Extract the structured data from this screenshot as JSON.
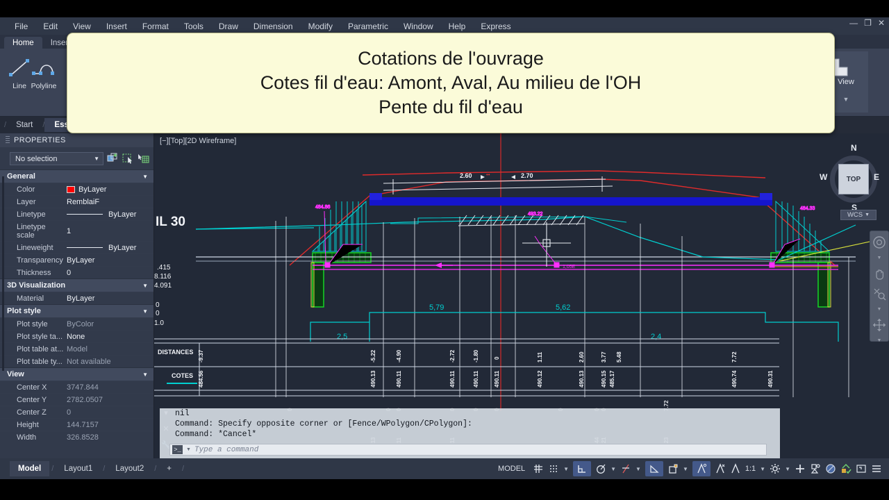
{
  "app": {
    "window_controls": [
      "minimize",
      "restore",
      "close"
    ]
  },
  "menubar": {
    "items": [
      "File",
      "Edit",
      "View",
      "Insert",
      "Format",
      "Tools",
      "Draw",
      "Dimension",
      "Modify",
      "Parametric",
      "Window",
      "Help",
      "Express"
    ]
  },
  "ribbon": {
    "tabs": [
      {
        "label": "Home",
        "active": true
      },
      {
        "label": "Insert",
        "active": false
      }
    ],
    "tools": [
      {
        "label": "Line",
        "icon": "line-icon"
      },
      {
        "label": "Polyline",
        "icon": "polyline-icon"
      }
    ],
    "view_panel": {
      "label": "View",
      "icon": "view-icon"
    }
  },
  "file_tabs": [
    {
      "label": "Start",
      "selected": false
    },
    {
      "label": "Essai",
      "selected": true
    }
  ],
  "properties": {
    "title": "PROPERTIES",
    "selection": "No selection",
    "toolbar_icons": [
      "quick-select-icon",
      "select-objects-icon",
      "pickadd-icon"
    ],
    "groups": [
      {
        "name": "General",
        "rows": [
          {
            "key": "Color",
            "value": "ByLayer",
            "swatch": "#ff0000"
          },
          {
            "key": "Layer",
            "value": "RemblaiF"
          },
          {
            "key": "Linetype",
            "value": "ByLayer",
            "line": true
          },
          {
            "key": "Linetype scale",
            "value": "1"
          },
          {
            "key": "Lineweight",
            "value": "ByLayer",
            "line": true
          },
          {
            "key": "Transparency",
            "value": "ByLayer"
          },
          {
            "key": "Thickness",
            "value": "0"
          }
        ]
      },
      {
        "name": "3D Visualization",
        "rows": [
          {
            "key": "Material",
            "value": "ByLayer"
          }
        ]
      },
      {
        "name": "Plot style",
        "rows": [
          {
            "key": "Plot style",
            "value": "ByColor",
            "dim": true
          },
          {
            "key": "Plot style ta...",
            "value": "None"
          },
          {
            "key": "Plot table at...",
            "value": "Model",
            "dim": true
          },
          {
            "key": "Plot table ty...",
            "value": "Not available",
            "dim": true
          }
        ]
      },
      {
        "name": "View",
        "rows": [
          {
            "key": "Center X",
            "value": "3747.844",
            "dim": true
          },
          {
            "key": "Center Y",
            "value": "2782.0507",
            "dim": true
          },
          {
            "key": "Center Z",
            "value": "0",
            "dim": true
          },
          {
            "key": "Height",
            "value": "144.7157",
            "dim": true
          },
          {
            "key": "Width",
            "value": "326.8528",
            "dim": true
          }
        ]
      }
    ]
  },
  "canvas": {
    "viewport_label": "[−][Top][2D Wireframe]",
    "viewcube": {
      "face": "TOP",
      "n": "N",
      "e": "E",
      "s": "S",
      "w": "W",
      "ucs": "WCS"
    },
    "left_edge_texts": [
      "IL   30",
      ".415",
      "8.116",
      "4.091",
      "0",
      "0",
      "1.0"
    ],
    "top_dimensions": [
      "2.60",
      "2.70"
    ],
    "span_dimensions": [
      "2,5",
      "5,79",
      "5,62",
      "2,4"
    ],
    "elevation_callouts": [
      "484.86",
      "493.22",
      "484.33"
    ],
    "slope_label": "1,05E",
    "table": {
      "row_labels": [
        "DISTANCES",
        "COTES"
      ],
      "distances": [
        "-9.37",
        "-5.22",
        "-4.90",
        "-2.72",
        "-1.80",
        "0",
        "1.11",
        "2.60",
        "3.77",
        "5.48",
        "7.72"
      ],
      "cotes": [
        "484.56",
        "490.13",
        "490.11",
        "490.11",
        "490.11",
        "490.11",
        "490.12",
        "490.13",
        "490.15",
        "485.17",
        "490.74",
        "490.31"
      ]
    },
    "overlay": {
      "lines": [
        "Cotations de l'ouvrage",
        "Cotes fil d'eau: Amont, Aval, Au milieu de l'OH",
        "Pente du fil d'eau"
      ],
      "background": "#fbfbd9"
    }
  },
  "command_line": {
    "history": [
      "nil",
      "Command: Specify opposite corner or [Fence/WPolygon/CPolygon]:",
      "Command: *Cancel*"
    ],
    "placeholder": "Type a command",
    "prompt_glyph": ">_"
  },
  "layout_tabs": [
    {
      "label": "Model",
      "selected": true
    },
    {
      "label": "Layout1",
      "selected": false
    },
    {
      "label": "Layout2",
      "selected": false
    },
    {
      "label": "+",
      "selected": false
    }
  ],
  "status_bar": {
    "space": "MODEL",
    "scale": "1:1",
    "items": [
      "grid-icon",
      "snap-icon",
      "ortho-icon",
      "polar-icon",
      "isodraft-icon",
      "otrack-icon",
      "lineweight-icon",
      "transparency-icon",
      "selection-cycling-icon",
      "annotation-visibility-icon",
      "annotation-scale-icon",
      "workspace-icon",
      "hardware-accel-icon",
      "isolate-objects-icon",
      "clean-screen-icon",
      "customization-icon"
    ]
  },
  "colors": {
    "canvas_bg": "#222937",
    "panel_bg": "#323a4b",
    "accent_blue": "#44598a",
    "cyan": "#00d7d7",
    "magenta": "#ff00ff",
    "green": "#00ff00",
    "red": "#ff0000"
  }
}
